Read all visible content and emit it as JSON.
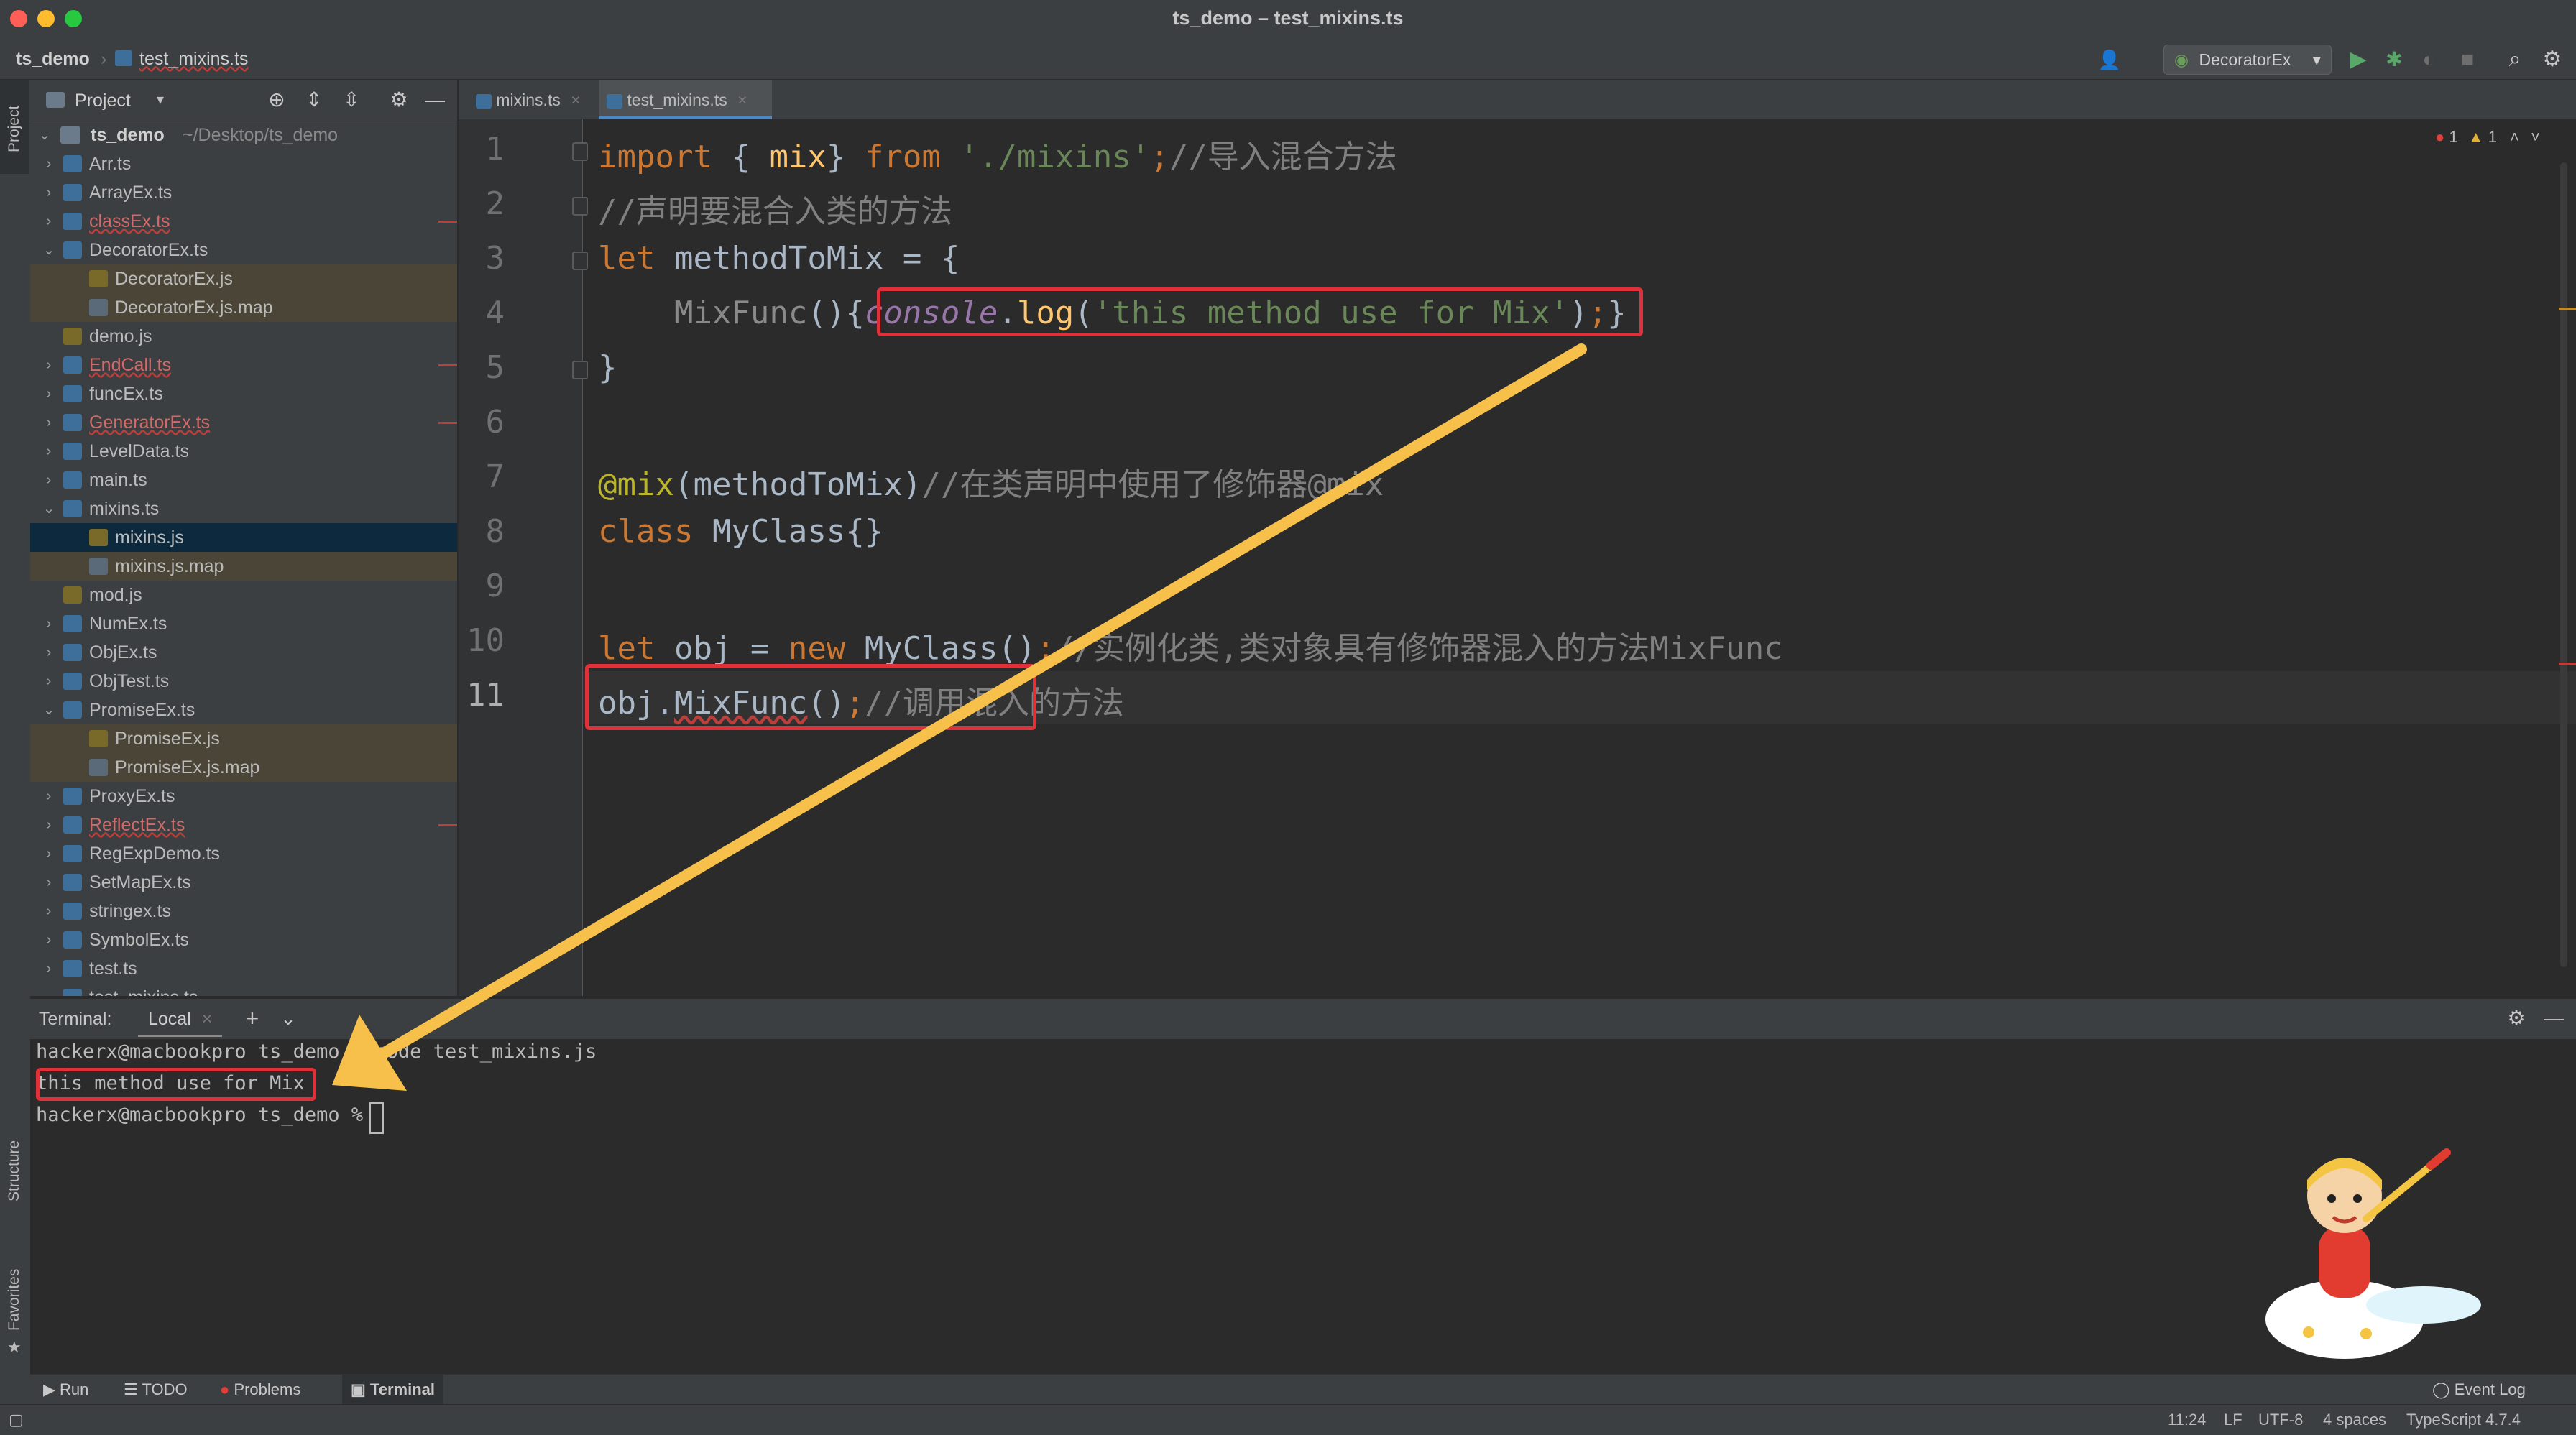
{
  "window": {
    "title": "ts_demo – test_mixins.ts",
    "traffic_colors": {
      "close": "#ff5f57",
      "minimize": "#febc2e",
      "maximize": "#28c840"
    }
  },
  "navbar": {
    "breadcrumb_project": "ts_demo",
    "breadcrumb_file": "test_mixins.ts",
    "run_config": "DecoratorEx"
  },
  "left_strip": {
    "project": "Project",
    "structure": "Structure",
    "favorites": "Favorites"
  },
  "project_panel": {
    "title": "Project",
    "root": {
      "name": "ts_demo",
      "path": "~/Desktop/ts_demo"
    },
    "items": [
      {
        "label": "Arr.ts",
        "type": "ts",
        "level": 1,
        "state": "collapsed",
        "error": false,
        "highlight": "none"
      },
      {
        "label": "ArrayEx.ts",
        "type": "ts",
        "level": 1,
        "state": "collapsed",
        "error": false,
        "highlight": "none"
      },
      {
        "label": "classEx.ts",
        "type": "ts",
        "level": 1,
        "state": "collapsed",
        "error": true,
        "highlight": "none"
      },
      {
        "label": "DecoratorEx.ts",
        "type": "ts",
        "level": 1,
        "state": "expanded",
        "error": false,
        "highlight": "none"
      },
      {
        "label": "DecoratorEx.js",
        "type": "js",
        "level": 2,
        "state": "leaf",
        "error": false,
        "highlight": "sub"
      },
      {
        "label": "DecoratorEx.js.map",
        "type": "map",
        "level": 2,
        "state": "leaf",
        "error": false,
        "highlight": "sub"
      },
      {
        "label": "demo.js",
        "type": "js",
        "level": 1,
        "state": "leaf",
        "error": false,
        "highlight": "none"
      },
      {
        "label": "EndCall.ts",
        "type": "ts",
        "level": 1,
        "state": "collapsed",
        "error": true,
        "highlight": "none"
      },
      {
        "label": "funcEx.ts",
        "type": "ts",
        "level": 1,
        "state": "collapsed",
        "error": false,
        "highlight": "none"
      },
      {
        "label": "GeneratorEx.ts",
        "type": "ts",
        "level": 1,
        "state": "collapsed",
        "error": true,
        "highlight": "none"
      },
      {
        "label": "LevelData.ts",
        "type": "ts",
        "level": 1,
        "state": "collapsed",
        "error": false,
        "highlight": "none"
      },
      {
        "label": "main.ts",
        "type": "ts",
        "level": 1,
        "state": "collapsed",
        "error": false,
        "highlight": "none"
      },
      {
        "label": "mixins.ts",
        "type": "ts",
        "level": 1,
        "state": "expanded",
        "error": false,
        "highlight": "none"
      },
      {
        "label": "mixins.js",
        "type": "js",
        "level": 2,
        "state": "leaf",
        "error": false,
        "highlight": "selected"
      },
      {
        "label": "mixins.js.map",
        "type": "map",
        "level": 2,
        "state": "leaf",
        "error": false,
        "highlight": "sub"
      },
      {
        "label": "mod.js",
        "type": "js",
        "level": 1,
        "state": "leaf",
        "error": false,
        "highlight": "none"
      },
      {
        "label": "NumEx.ts",
        "type": "ts",
        "level": 1,
        "state": "collapsed",
        "error": false,
        "highlight": "none"
      },
      {
        "label": "ObjEx.ts",
        "type": "ts",
        "level": 1,
        "state": "collapsed",
        "error": false,
        "highlight": "none"
      },
      {
        "label": "ObjTest.ts",
        "type": "ts",
        "level": 1,
        "state": "collapsed",
        "error": false,
        "highlight": "none"
      },
      {
        "label": "PromiseEx.ts",
        "type": "ts",
        "level": 1,
        "state": "expanded",
        "error": false,
        "highlight": "none"
      },
      {
        "label": "PromiseEx.js",
        "type": "js",
        "level": 2,
        "state": "leaf",
        "error": false,
        "highlight": "sub"
      },
      {
        "label": "PromiseEx.js.map",
        "type": "map",
        "level": 2,
        "state": "leaf",
        "error": false,
        "highlight": "sub"
      },
      {
        "label": "ProxyEx.ts",
        "type": "ts",
        "level": 1,
        "state": "collapsed",
        "error": false,
        "highlight": "none"
      },
      {
        "label": "ReflectEx.ts",
        "type": "ts",
        "level": 1,
        "state": "collapsed",
        "error": true,
        "highlight": "none"
      },
      {
        "label": "RegExpDemo.ts",
        "type": "ts",
        "level": 1,
        "state": "collapsed",
        "error": false,
        "highlight": "none"
      },
      {
        "label": "SetMapEx.ts",
        "type": "ts",
        "level": 1,
        "state": "collapsed",
        "error": false,
        "highlight": "none"
      },
      {
        "label": "stringex.ts",
        "type": "ts",
        "level": 1,
        "state": "collapsed",
        "error": false,
        "highlight": "none"
      },
      {
        "label": "SymbolEx.ts",
        "type": "ts",
        "level": 1,
        "state": "collapsed",
        "error": false,
        "highlight": "none"
      },
      {
        "label": "test.ts",
        "type": "ts",
        "level": 1,
        "state": "collapsed",
        "error": false,
        "highlight": "none"
      },
      {
        "label": "test_mixins.ts",
        "type": "ts",
        "level": 1,
        "state": "expanded",
        "error": false,
        "highlight": "none"
      }
    ]
  },
  "editor": {
    "tabs": [
      {
        "label": "mixins.ts",
        "active": false
      },
      {
        "label": "test_mixins.ts",
        "active": true
      }
    ],
    "inspection": {
      "errors": "1",
      "warnings": "1"
    },
    "current_line": 11,
    "lines": [
      {
        "n": "1",
        "tokens": [
          [
            "kw",
            "import"
          ],
          [
            "p",
            " { "
          ],
          [
            "fn",
            "mix"
          ],
          [
            "p",
            "} "
          ],
          [
            "kw",
            "from"
          ],
          [
            "p",
            " "
          ],
          [
            "str",
            "'./mixins'"
          ],
          [
            "kw",
            ";"
          ],
          [
            "cmt",
            "//导入混合方法"
          ]
        ]
      },
      {
        "n": "2",
        "tokens": [
          [
            "cmt",
            "//声明要混合入类的方法"
          ]
        ]
      },
      {
        "n": "3",
        "tokens": [
          [
            "kw",
            "let"
          ],
          [
            "p",
            " methodToMix = {"
          ]
        ]
      },
      {
        "n": "4",
        "tokens": [
          [
            "p",
            "    "
          ],
          [
            "gray",
            "MixFunc"
          ],
          [
            "p",
            "(){"
          ],
          [
            "glob",
            "console"
          ],
          [
            "p",
            "."
          ],
          [
            "fn",
            "log"
          ],
          [
            "p",
            "("
          ],
          [
            "str",
            "'this method use for Mix'"
          ],
          [
            "p",
            ")"
          ],
          [
            "kw",
            ";"
          ],
          [
            "p",
            "}"
          ]
        ]
      },
      {
        "n": "5",
        "tokens": [
          [
            "p",
            "}"
          ]
        ]
      },
      {
        "n": "6",
        "tokens": []
      },
      {
        "n": "7",
        "tokens": [
          [
            "ann",
            "@mix"
          ],
          [
            "p",
            "(methodToMix)"
          ],
          [
            "cmt",
            "//在类声明中使用了修饰器@mix"
          ]
        ]
      },
      {
        "n": "8",
        "tokens": [
          [
            "kw",
            "class"
          ],
          [
            "p",
            " MyClass{}"
          ]
        ]
      },
      {
        "n": "9",
        "tokens": []
      },
      {
        "n": "10",
        "tokens": [
          [
            "kw",
            "let"
          ],
          [
            "p",
            " obj = "
          ],
          [
            "kw",
            "new"
          ],
          [
            "p",
            " MyClass()"
          ],
          [
            "kw",
            ";"
          ],
          [
            "cmt",
            "//实例化类,类对象具有修饰器混入的方法MixFunc"
          ]
        ]
      },
      {
        "n": "11",
        "tokens": [
          [
            "p",
            "obj."
          ],
          [
            "p",
            "MixFunc"
          ],
          [
            "p",
            "()"
          ],
          [
            "kw",
            ";"
          ],
          [
            "cmt",
            "//调用混入的方法"
          ]
        ]
      }
    ]
  },
  "terminal": {
    "label": "Terminal:",
    "tab": "Local",
    "lines": [
      "hackerx@macbookpro ts_demo % node test_mixins.js",
      "this method use for Mix",
      "hackerx@macbookpro ts_demo % "
    ]
  },
  "bottom_tools": [
    "Run",
    "TODO",
    "Problems",
    "Terminal"
  ],
  "event_log": "Event Log",
  "status": {
    "position": "11:24",
    "line_sep": "LF",
    "encoding": "UTF-8",
    "indent": "4 spaces",
    "language": "TypeScript 4.7.4"
  },
  "annotation_color": "#e0313a",
  "arrow_color": "#f7c04a"
}
